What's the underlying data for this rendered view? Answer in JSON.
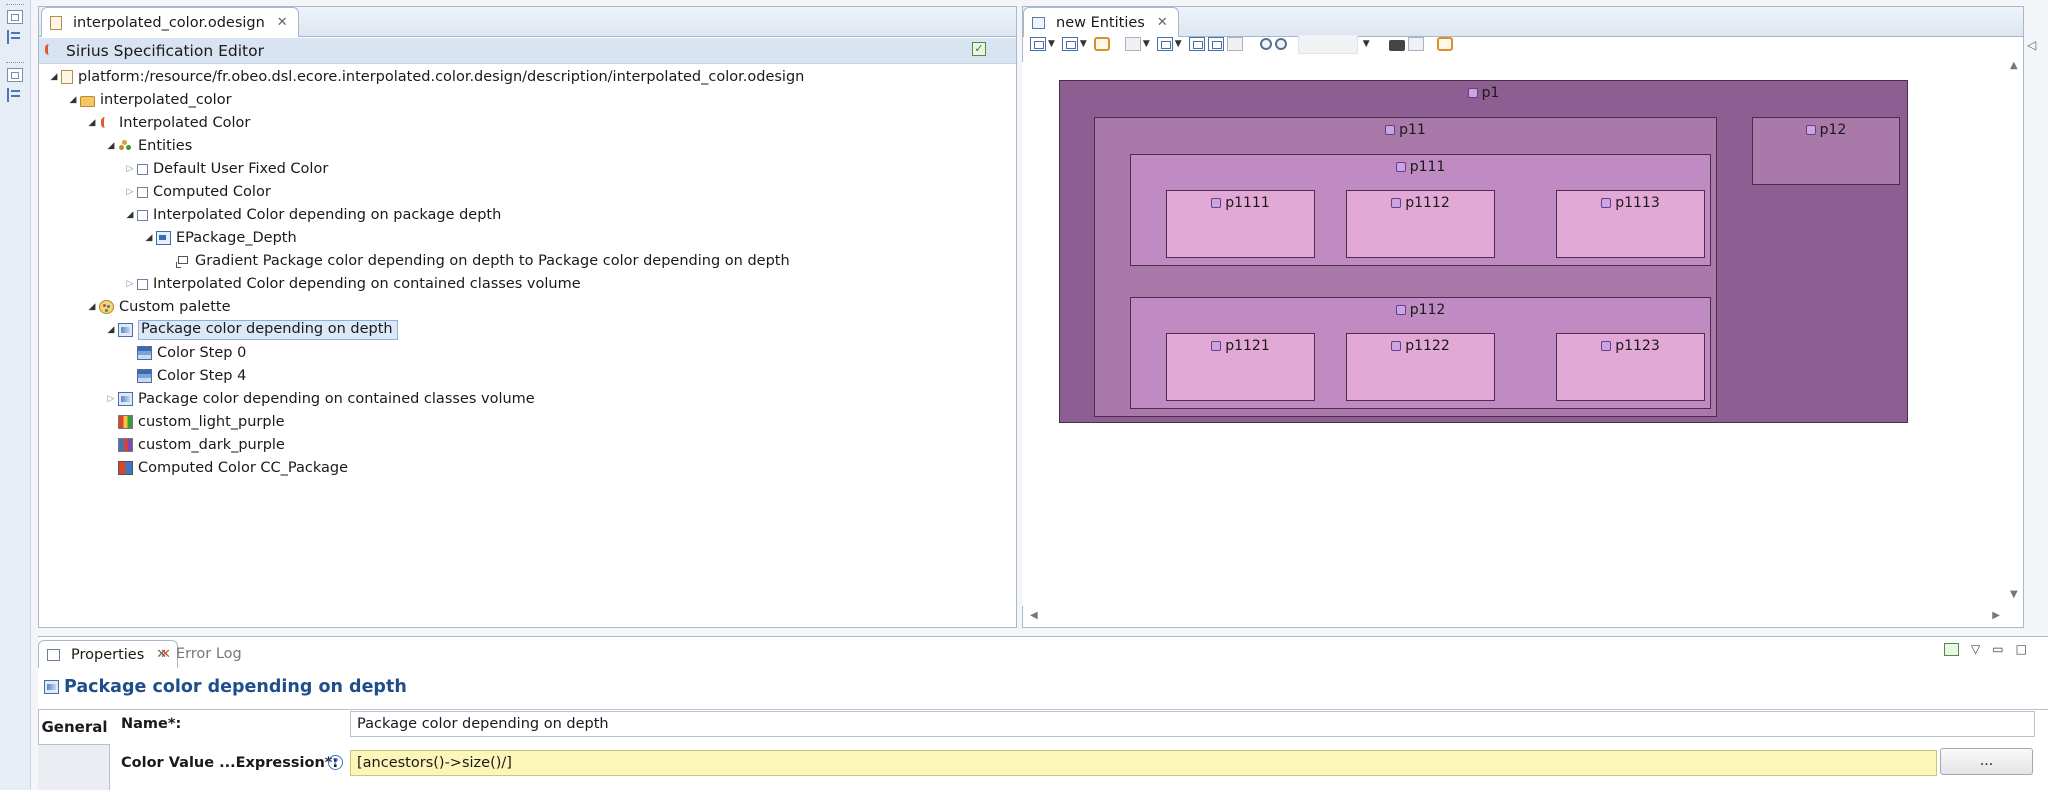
{
  "left_trim": {
    "icons": [
      "restore-icon",
      "tree-icon",
      "restore-icon",
      "outline-icon"
    ]
  },
  "editor": {
    "tab_label": "interpolated_color.odesign",
    "title": "Sirius Specification Editor",
    "tree": [
      {
        "label": "platform:/resource/fr.obeo.dsl.ecore.interpolated.color.design/description/interpolated_color.odesign",
        "depth": 0,
        "expanded": true,
        "icon": "file-icon"
      },
      {
        "label": "interpolated_color",
        "depth": 1,
        "expanded": true,
        "icon": "folder-icon"
      },
      {
        "label": "Interpolated Color",
        "depth": 2,
        "expanded": true,
        "icon": "viewpoint-icon"
      },
      {
        "label": "Entities",
        "depth": 3,
        "expanded": true,
        "icon": "diagram-icon"
      },
      {
        "label": "Default User Fixed Color",
        "depth": 4,
        "expanded": false,
        "icon": "node-icon"
      },
      {
        "label": "Computed Color",
        "depth": 4,
        "expanded": false,
        "icon": "node-icon"
      },
      {
        "label": "Interpolated Color depending on package depth",
        "depth": 4,
        "expanded": true,
        "icon": "node-icon"
      },
      {
        "label": "EPackage_Depth",
        "depth": 5,
        "expanded": true,
        "icon": "container-mapping-icon"
      },
      {
        "label": "Gradient Package color depending on depth to Package color depending on depth",
        "depth": 6,
        "expanded": null,
        "icon": "edge-style-icon"
      },
      {
        "label": "Interpolated Color depending on contained classes volume",
        "depth": 4,
        "expanded": false,
        "icon": "node-icon"
      },
      {
        "label": "Custom palette",
        "depth": 2,
        "expanded": true,
        "icon": "palette-icon"
      },
      {
        "label": "Package color depending on depth",
        "depth": 3,
        "expanded": true,
        "icon": "interpolated-color-icon",
        "selected": true
      },
      {
        "label": "Color Step 0",
        "depth": 4,
        "expanded": null,
        "icon": "color-step-icon"
      },
      {
        "label": "Color Step 4",
        "depth": 4,
        "expanded": null,
        "icon": "color-step-icon"
      },
      {
        "label": "Package color depending on contained classes volume",
        "depth": 3,
        "expanded": false,
        "icon": "interpolated-color-icon"
      },
      {
        "label": "custom_light_purple",
        "depth": 3,
        "expanded": null,
        "icon": "fixed-color-icon"
      },
      {
        "label": "custom_dark_purple",
        "depth": 3,
        "expanded": null,
        "icon": "fixed-color-icon"
      },
      {
        "label": "Computed Color CC_Package",
        "depth": 3,
        "expanded": null,
        "icon": "computed-color-icon"
      }
    ]
  },
  "diagram": {
    "tab_label": "new Entities",
    "zoom_value": "",
    "packages": {
      "p1": "p1",
      "p11": "p11",
      "p12": "p12",
      "p111": "p111",
      "p112": "p112",
      "p1111": "p1111",
      "p1112": "p1112",
      "p1113": "p1113",
      "p1121": "p1121",
      "p1122": "p1122",
      "p1123": "p1123"
    },
    "colors": {
      "depth1": "#8c5e92",
      "depth2": "#a97aa9",
      "depth3": "#c08bc3",
      "depth4": "#e3a9d6"
    }
  },
  "properties": {
    "tab_label": "Properties",
    "error_tab_label": "Error Log",
    "heading": "Package color depending on depth",
    "section_tab": "General",
    "name_label": "Name*:",
    "name_value": "Package color depending on depth",
    "expr_label": "Color Value ...Expression*:",
    "expr_value": "[ancestors()->size()/]",
    "browse_label": "...",
    "help_glyph": "?"
  }
}
